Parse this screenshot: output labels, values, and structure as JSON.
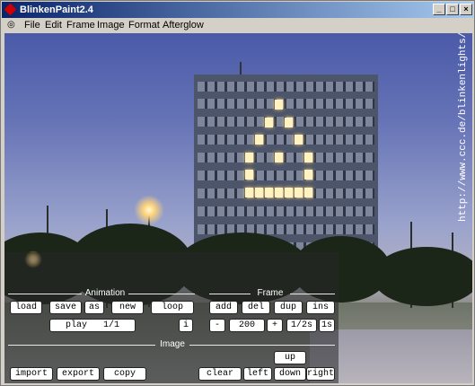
{
  "window": {
    "title": "BlinkenPaint2.4"
  },
  "menu": [
    "File",
    "Edit",
    "Frame",
    "Image",
    "Format",
    "Afterglow"
  ],
  "url_text": "http://www.ccc.de/blinkenlights/",
  "animation": {
    "heading": "Animation",
    "load": "load",
    "save": "save",
    "as": "as",
    "new": "new",
    "loop": "loop",
    "play": "play",
    "position": "1/1",
    "info": "i"
  },
  "frame": {
    "heading": "Frame",
    "add": "add",
    "del": "del",
    "dup": "dup",
    "ins": "ins",
    "minus": "-",
    "duration": "200",
    "plus": "+",
    "half": "1/2s",
    "one": "1s"
  },
  "image": {
    "heading": "Image",
    "import": "import",
    "export": "export",
    "copy": "copy",
    "clear": "clear",
    "up": "up",
    "left": "left",
    "down": "down",
    "right": "right"
  },
  "colors": {
    "titlebar": "#0a246a",
    "pixel_on": "#fff3c4"
  }
}
